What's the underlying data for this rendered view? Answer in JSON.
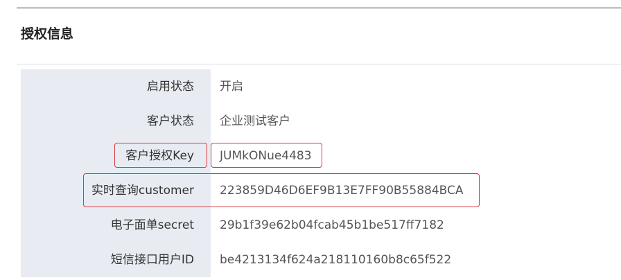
{
  "section": {
    "title": "授权信息"
  },
  "rows": [
    {
      "label": "启用状态",
      "value": "开启"
    },
    {
      "label": "客户状态",
      "value": "企业测试客户"
    },
    {
      "label": "客户授权Key",
      "value": "JUMkONue4483"
    },
    {
      "label": "实时查询customer",
      "value": "223859D46D6EF9B13E7FF90B55884BCA"
    },
    {
      "label": "电子面单secret",
      "value": "29b1f39e62b04fcab45b1be517ff7182"
    },
    {
      "label": "短信接口用户ID",
      "value": "be4213134f624a218110160b8c65f522"
    }
  ],
  "colors": {
    "label_bg": "#e8ecf2",
    "highlight": "#d9363e"
  }
}
